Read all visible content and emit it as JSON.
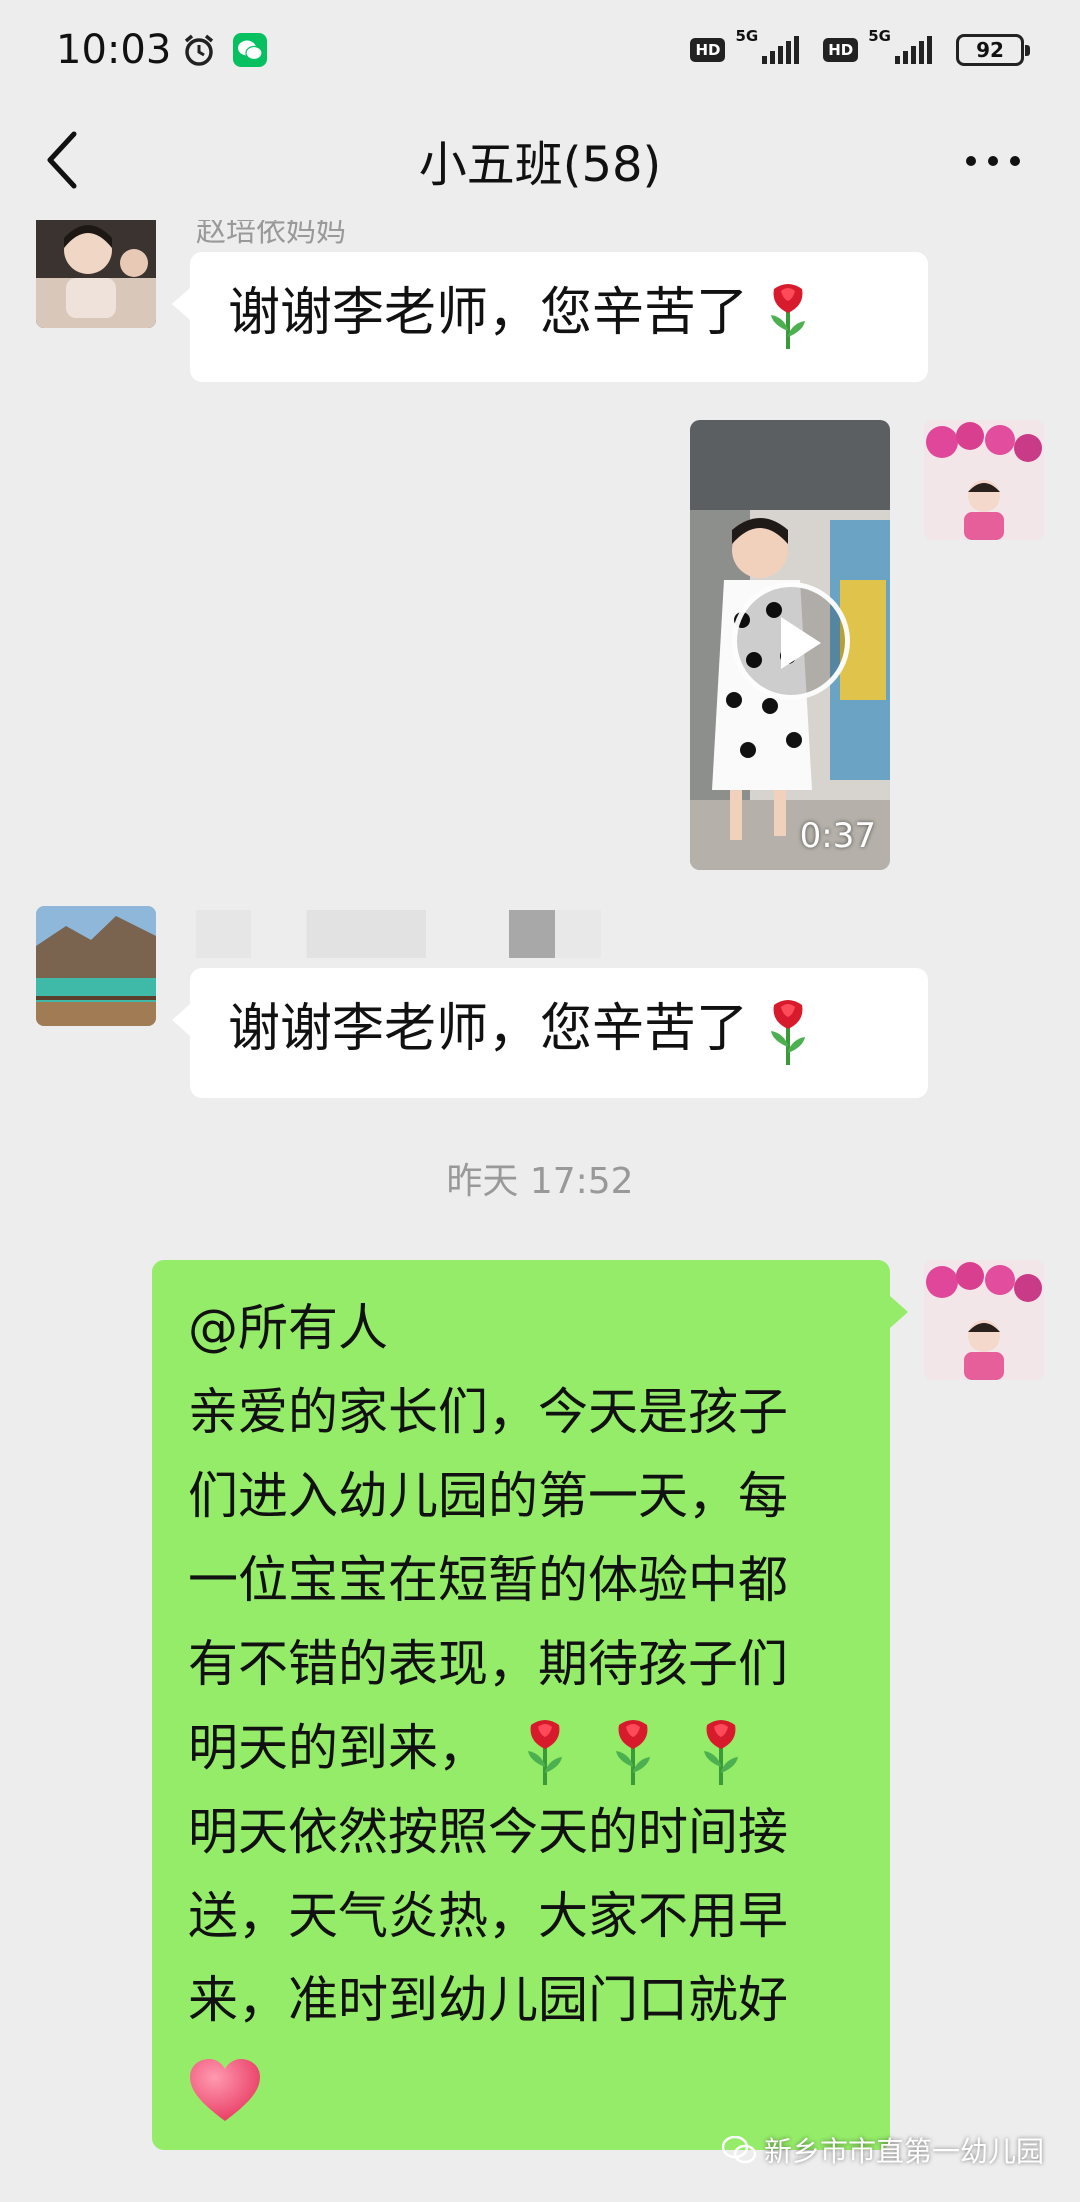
{
  "status_bar": {
    "time": "10:03",
    "hd1": "HD",
    "net1": "5G",
    "hd2": "HD",
    "net2": "5G",
    "battery": "92"
  },
  "nav": {
    "title": "小五班(58)"
  },
  "messages": {
    "m1_sender": "赵培依妈妈",
    "m1_text": "谢谢李老师，您辛苦了",
    "m2_video_duration": "0:37",
    "m3_text": "谢谢李老师，您辛苦了",
    "divider_time": "昨天 17:52",
    "m4_lines": [
      "@所有人",
      "亲爱的家长们，今天是孩子",
      "们进入幼儿园的第一天，每",
      "一位宝宝在短暂的体验中都",
      "有不错的表现，期待孩子们",
      "明天的到来，",
      "明天依然按照今天的时间接",
      "送，天气炎热，大家不用早",
      "来，准时到幼儿园门口就好"
    ]
  },
  "watermark": "新乡市市直第一幼儿园",
  "icons": {
    "rose": "rose-emoji",
    "heart": "heart-emoji"
  }
}
